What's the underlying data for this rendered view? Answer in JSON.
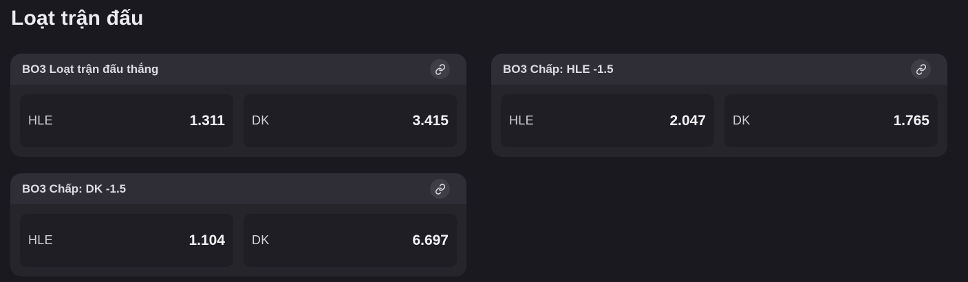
{
  "section": {
    "title": "Loạt trận đấu"
  },
  "markets": [
    {
      "title": "BO3 Loạt trận đấu thắng",
      "link_icon": "link-icon",
      "options": [
        {
          "team": "HLE",
          "odd": "1.311"
        },
        {
          "team": "DK",
          "odd": "3.415"
        }
      ]
    },
    {
      "title": "BO3 Chấp: HLE -1.5",
      "link_icon": "link-icon",
      "options": [
        {
          "team": "HLE",
          "odd": "2.047"
        },
        {
          "team": "DK",
          "odd": "1.765"
        }
      ]
    },
    {
      "title": "BO3 Chấp: DK -1.5",
      "link_icon": "link-icon",
      "options": [
        {
          "team": "HLE",
          "odd": "1.104"
        },
        {
          "team": "DK",
          "odd": "6.697"
        }
      ]
    }
  ]
}
